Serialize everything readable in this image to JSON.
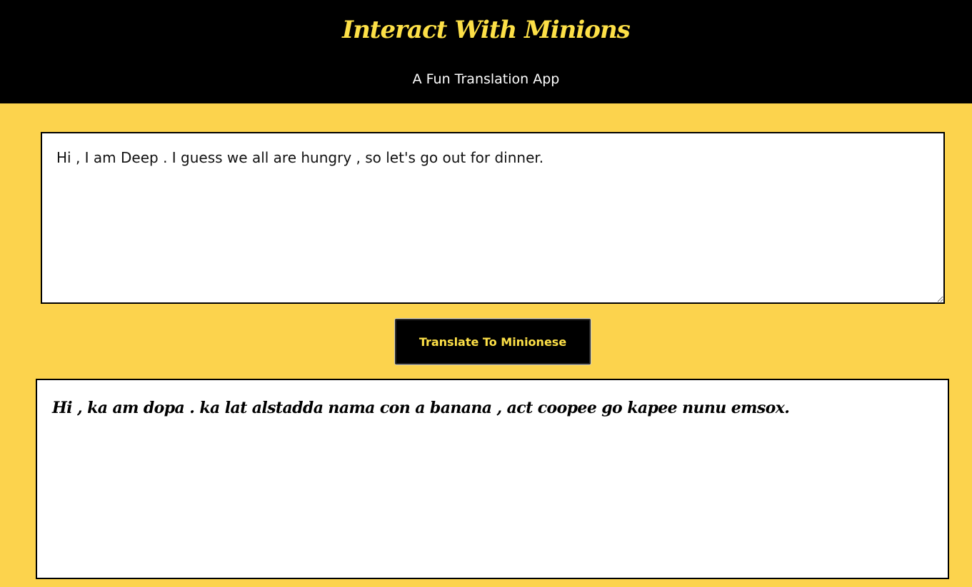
{
  "header": {
    "title": "Interact With Minions",
    "subtitle": "A Fun Translation App"
  },
  "input": {
    "value": "Hi , I am Deep . I guess we all are hungry , so let's go out for dinner."
  },
  "translate_button": {
    "label": "Translate To Minionese"
  },
  "output": {
    "text": "Hi , ka am dopa . ka lat alstadda nama con a banana , act coopee go kapee nunu emsox."
  },
  "colors": {
    "background": "#FCD34D",
    "header_bg": "#000000",
    "accent_yellow": "#FDE047",
    "panel_bg": "#FFFFFF"
  }
}
